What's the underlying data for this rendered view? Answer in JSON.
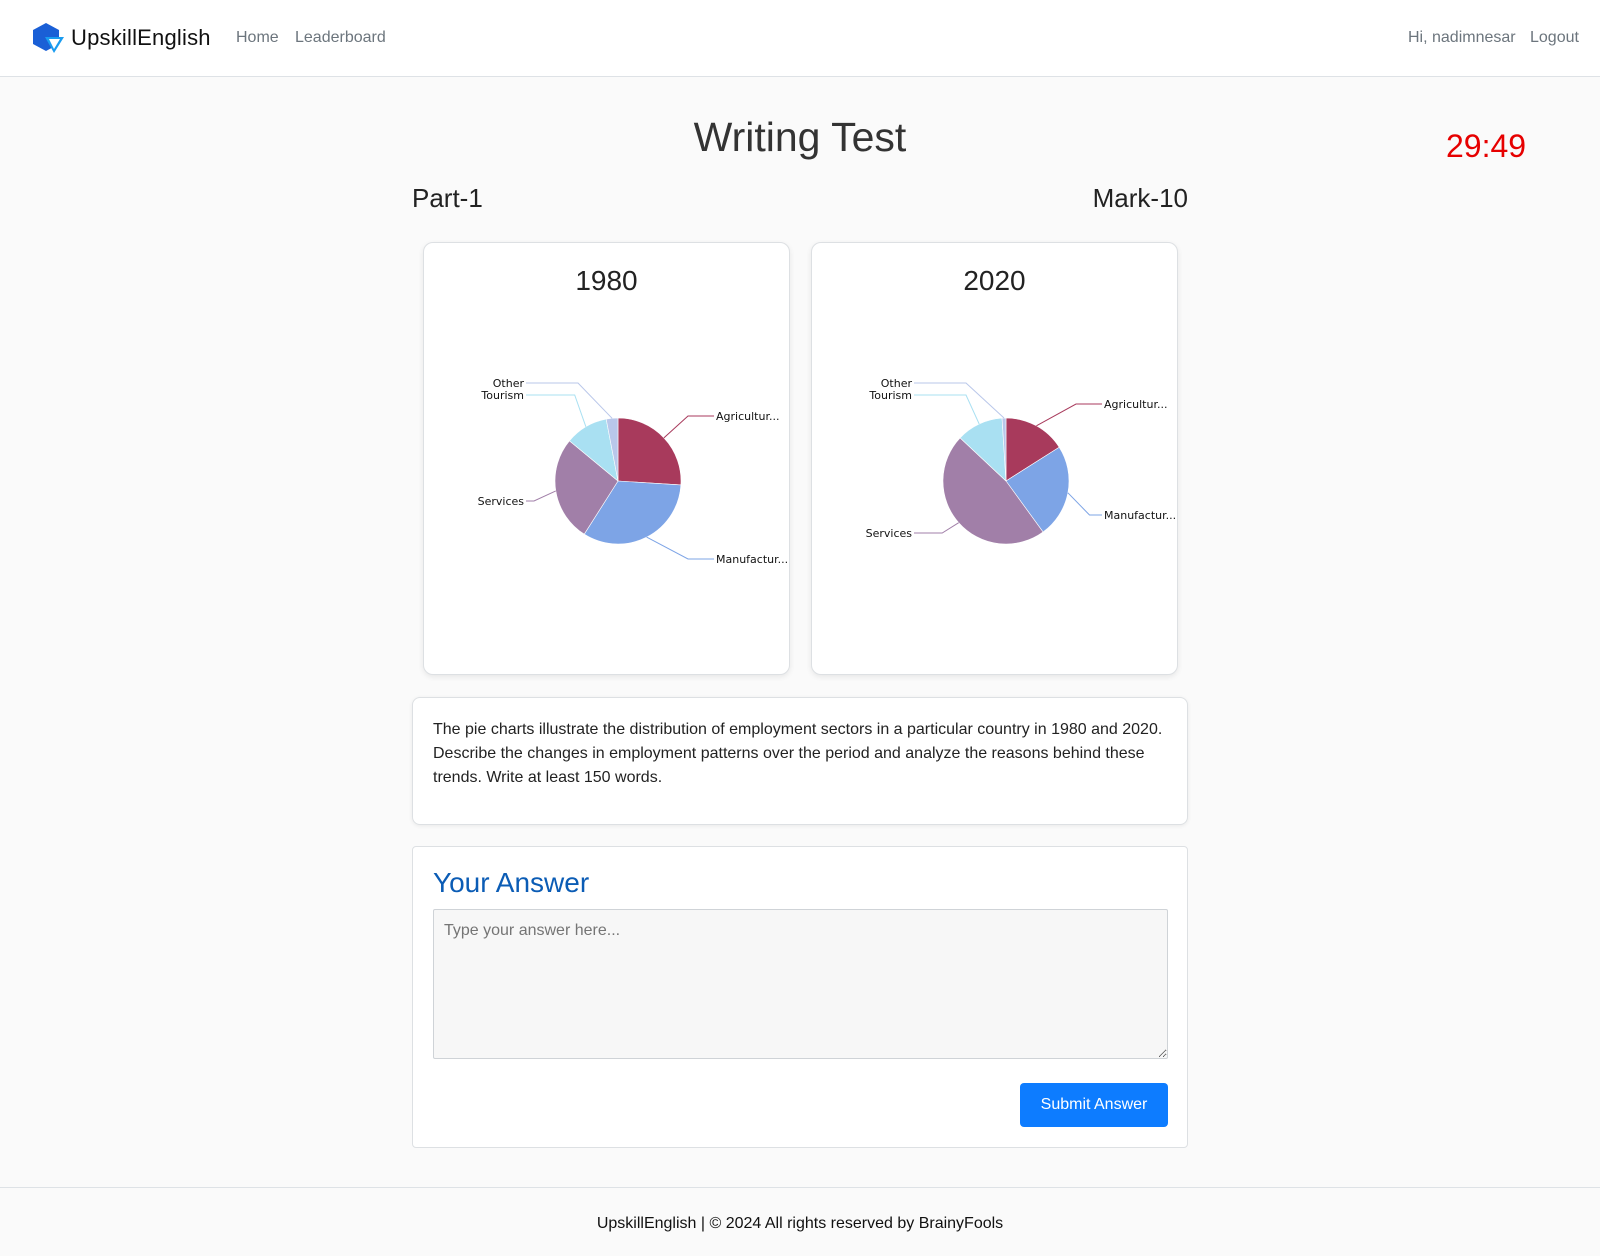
{
  "navbar": {
    "brand": "UpskillEnglish",
    "links": [
      "Home",
      "Leaderboard"
    ],
    "user_greeting": "Hi, nadimnesar",
    "logout": "Logout"
  },
  "page": {
    "title": "Writing Test",
    "timer": "29:49",
    "part": "Part-1",
    "mark": "Mark-10"
  },
  "colors": {
    "Agriculture": "#a83a5c",
    "Manufacturing": "#7da4e6",
    "Services": "#a17fa8",
    "Tourism": "#a9e0f2",
    "Other": "#b9c7ea",
    "timer": "#e60000",
    "accent": "#0d7cff",
    "answer_title": "#0b5cb5"
  },
  "chart_data": [
    {
      "type": "pie",
      "title": "1980",
      "categories": [
        "Agriculture",
        "Manufacturing",
        "Services",
        "Tourism",
        "Other"
      ],
      "display_labels": [
        "Agricultur...",
        "Manufactur...",
        "Services",
        "Tourism",
        "Other"
      ],
      "values": [
        26,
        33,
        27,
        11,
        3
      ]
    },
    {
      "type": "pie",
      "title": "2020",
      "categories": [
        "Agriculture",
        "Manufacturing",
        "Services",
        "Tourism",
        "Other"
      ],
      "display_labels": [
        "Agricultur...",
        "Manufactur...",
        "Services",
        "Tourism",
        "Other"
      ],
      "values": [
        16,
        24,
        47,
        12,
        1
      ]
    }
  ],
  "question": {
    "text": "The pie charts illustrate the distribution of employment sectors in a particular country in 1980 and 2020. Describe the changes in employment patterns over the period and analyze the reasons behind these trends. Write at least 150 words."
  },
  "answer": {
    "title": "Your Answer",
    "placeholder": "Type your answer here...",
    "value": "",
    "submit_label": "Submit Answer"
  },
  "footer": {
    "text": "UpskillEnglish | © 2024 All rights reserved by BrainyFools"
  }
}
